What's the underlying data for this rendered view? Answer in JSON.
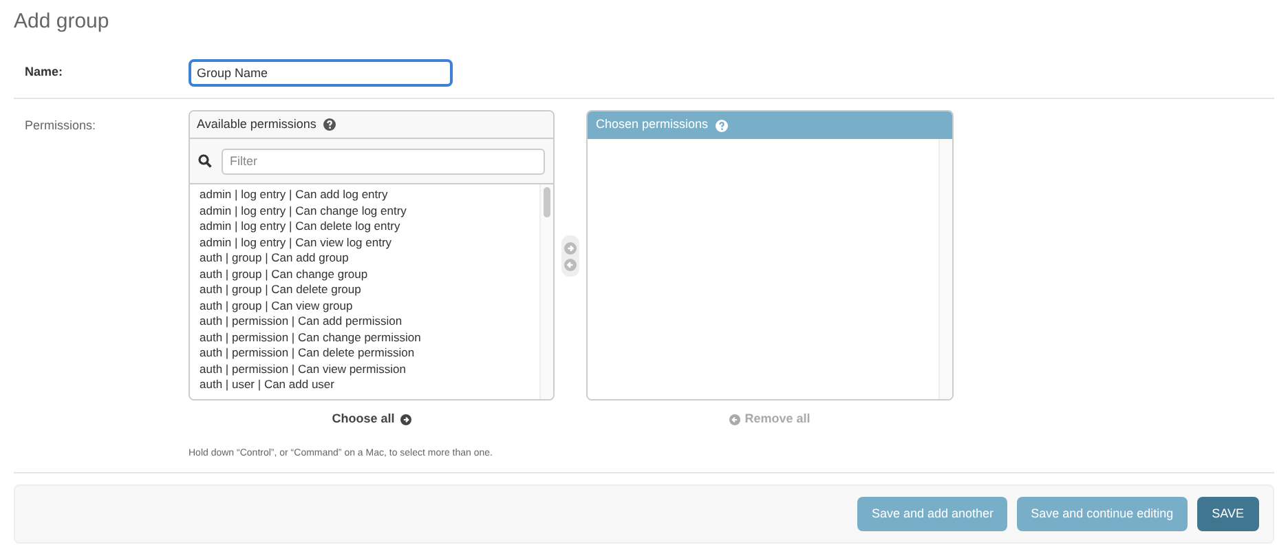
{
  "title": "Add group",
  "name_field": {
    "label": "Name:",
    "value": "Group Name"
  },
  "permissions": {
    "label": "Permissions:",
    "available": {
      "title": "Available permissions",
      "filter_placeholder": "Filter",
      "items": [
        "admin | log entry | Can add log entry",
        "admin | log entry | Can change log entry",
        "admin | log entry | Can delete log entry",
        "admin | log entry | Can view log entry",
        "auth | group | Can add group",
        "auth | group | Can change group",
        "auth | group | Can delete group",
        "auth | group | Can view group",
        "auth | permission | Can add permission",
        "auth | permission | Can change permission",
        "auth | permission | Can delete permission",
        "auth | permission | Can view permission",
        "auth | user | Can add user"
      ],
      "action": {
        "label": "Choose all",
        "disabled": false
      }
    },
    "chosen": {
      "title": "Chosen permissions",
      "action": {
        "label": "Remove all",
        "disabled": true
      }
    },
    "help": "Hold down “Control”, or “Command” on a Mac, to select more than one."
  },
  "buttons": [
    {
      "label": "Save and add another",
      "kind": "secondary"
    },
    {
      "label": "Save and continue editing",
      "kind": "secondary"
    },
    {
      "label": "SAVE",
      "kind": "primary"
    }
  ]
}
